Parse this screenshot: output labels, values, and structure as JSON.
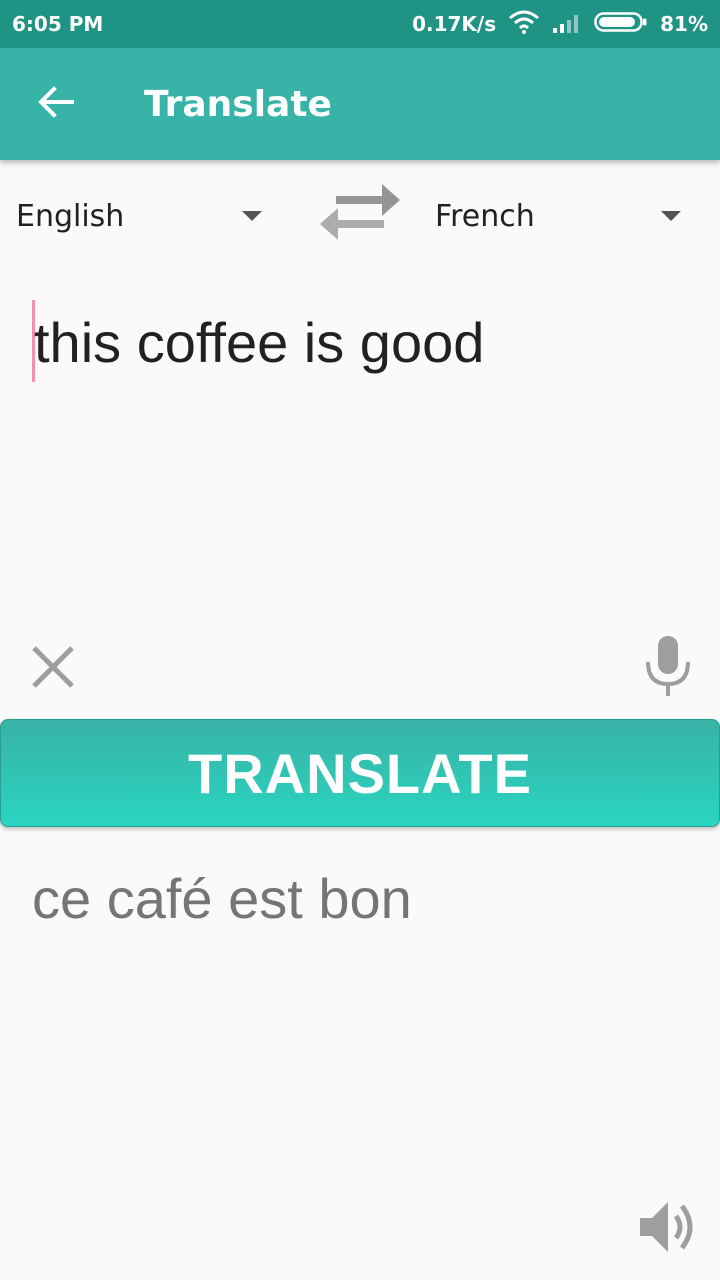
{
  "status_bar": {
    "time": "6:05 PM",
    "network_speed": "0.17K/s",
    "wifi_icon": "wifi-icon",
    "signal_icon": "signal-icon",
    "battery_icon": "battery-icon",
    "battery_percent": "81%"
  },
  "app_bar": {
    "back_icon": "arrow-back-icon",
    "title": "Translate",
    "color": "#37b3a7"
  },
  "languages": {
    "source": "English",
    "target": "French",
    "swap_icon": "swap-arrows-icon"
  },
  "input": {
    "text": "this coffee is good"
  },
  "actions": {
    "clear_icon": "close-icon",
    "mic_icon": "microphone-icon",
    "translate_label": "TRANSLATE"
  },
  "output": {
    "text": "ce café est bon",
    "speaker_icon": "speaker-icon"
  }
}
